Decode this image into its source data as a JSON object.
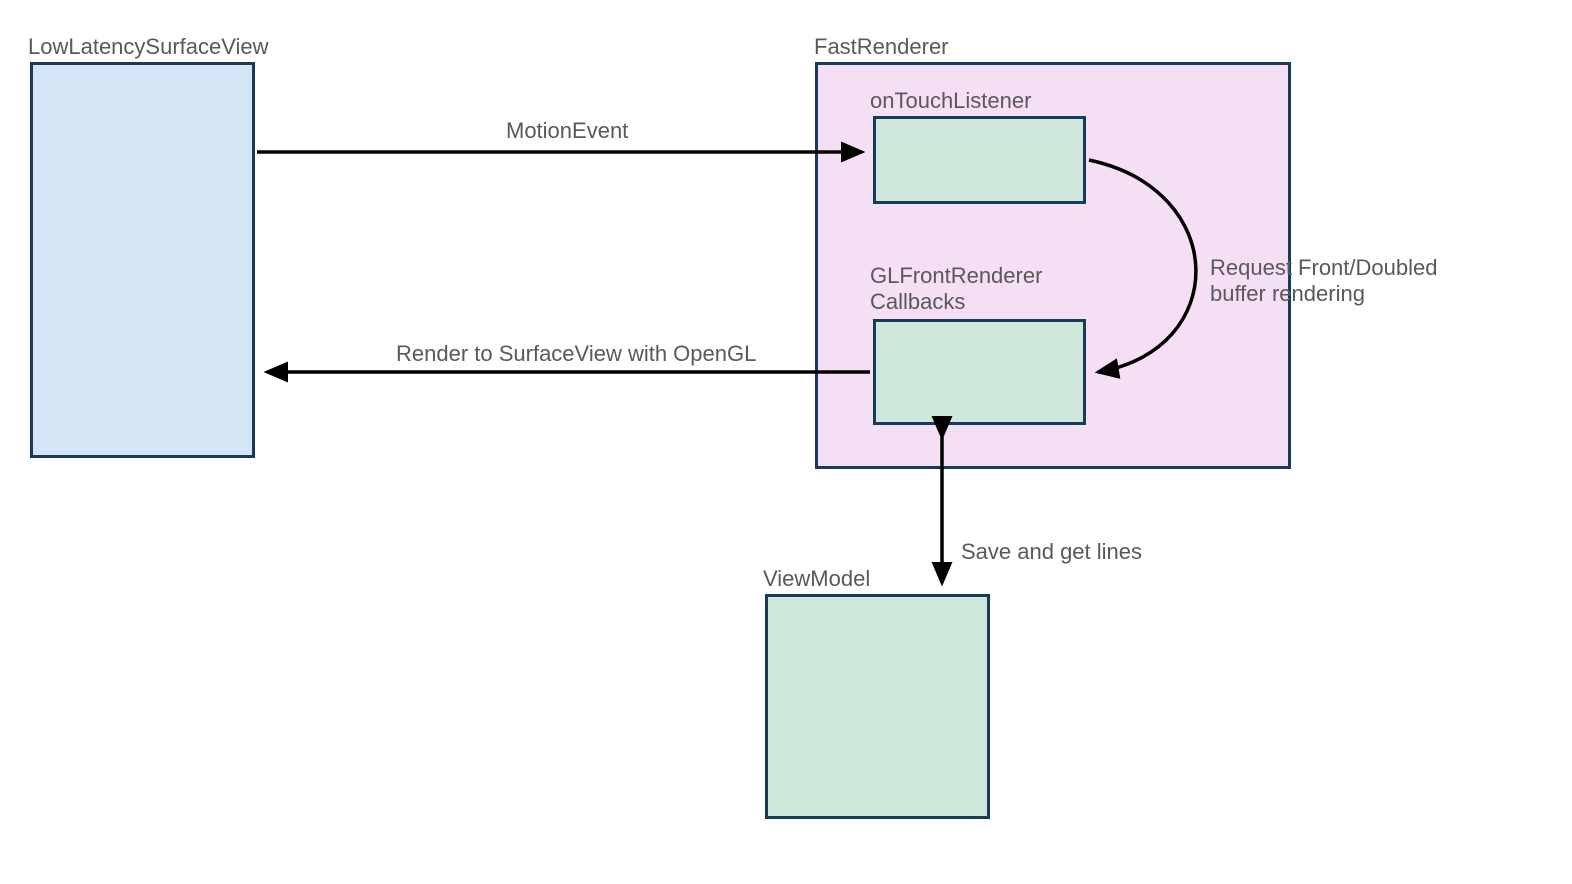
{
  "boxes": {
    "lowLatency": {
      "label": "LowLatencySurfaceView"
    },
    "fastRenderer": {
      "label": "FastRenderer"
    },
    "onTouch": {
      "label": "onTouchListener"
    },
    "glFront": {
      "label": "GLFrontRenderer\nCallbacks"
    },
    "viewModel": {
      "label": "ViewModel"
    }
  },
  "arrows": {
    "motionEvent": {
      "label": "MotionEvent"
    },
    "renderSurface": {
      "label": "Render to SurfaceView with OpenGL"
    },
    "requestBuffer": {
      "label": "Request Front/Doubled\nbuffer rendering"
    },
    "saveLines": {
      "label": "Save and get lines"
    }
  },
  "colors": {
    "boxBorder": "#1a3a5c",
    "arrow": "#000000",
    "text": "#595959",
    "lightBlue": "#d4e6f4",
    "lightPurple": "#f5dff5",
    "lightGreen": "#d0e8dc"
  }
}
